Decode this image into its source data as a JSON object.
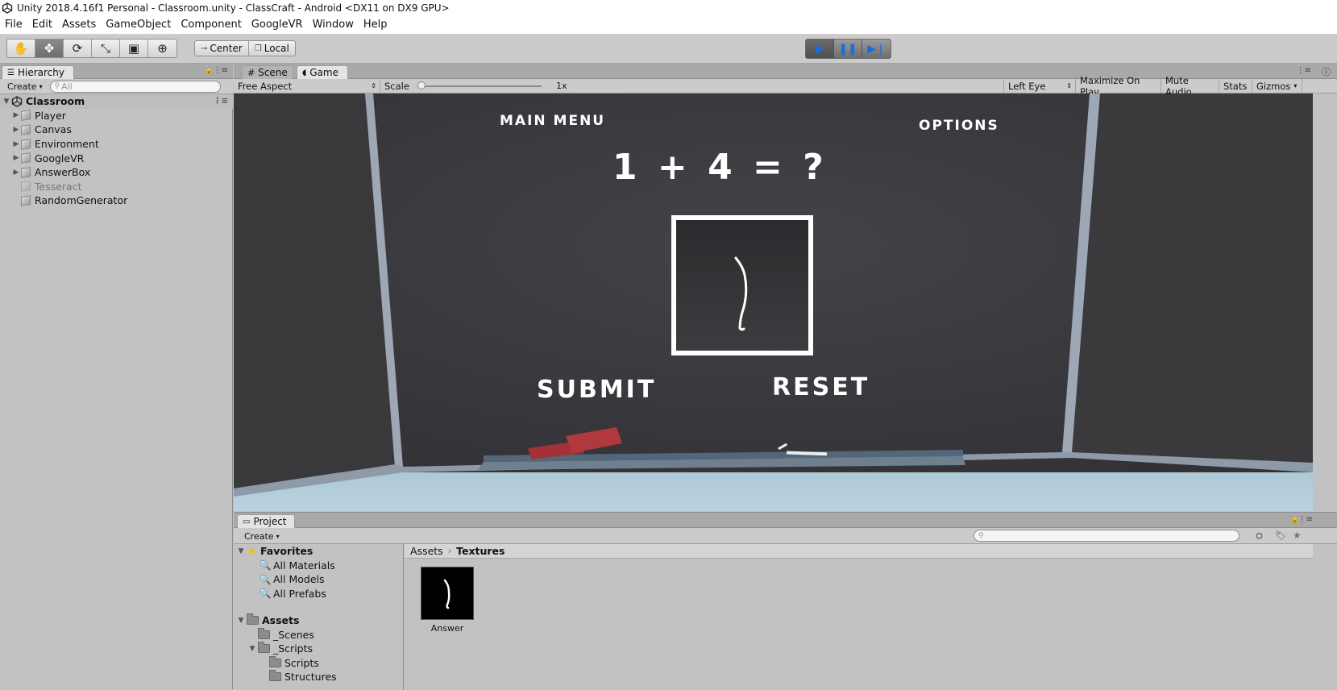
{
  "window": {
    "title": "Unity 2018.4.16f1 Personal - Classroom.unity - ClassCraft - Android <DX11 on DX9 GPU>"
  },
  "menu": [
    "File",
    "Edit",
    "Assets",
    "GameObject",
    "Component",
    "GoogleVR",
    "Window",
    "Help"
  ],
  "toolbar": {
    "pivot_center": "Center",
    "pivot_local": "Local",
    "accent": "#1a6fd6"
  },
  "hierarchy": {
    "tab": "Hierarchy",
    "create": "Create",
    "search_placeholder": "All",
    "scene": "Classroom",
    "items": [
      {
        "label": "Player",
        "expandable": true,
        "active": true
      },
      {
        "label": "Canvas",
        "expandable": true,
        "active": true
      },
      {
        "label": "Environment",
        "expandable": true,
        "active": true
      },
      {
        "label": "GoogleVR",
        "expandable": true,
        "active": true
      },
      {
        "label": "AnswerBox",
        "expandable": true,
        "active": true
      },
      {
        "label": "Tesseract",
        "expandable": false,
        "active": false
      },
      {
        "label": "RandomGenerator",
        "expandable": false,
        "active": true
      }
    ]
  },
  "view": {
    "tabs": [
      "Scene",
      "Game"
    ],
    "aspect": "Free Aspect",
    "scale_label": "Scale",
    "scale_value": "1x",
    "eye": "Left Eye",
    "maximize": "Maximize On Play",
    "mute": "Mute Audio",
    "stats": "Stats",
    "gizmos": "Gizmos"
  },
  "game": {
    "main_menu": "MAIN MENU",
    "options": "OPTIONS",
    "question": "1 + 4 = ?",
    "submit": "SUBMIT",
    "reset": "RESET"
  },
  "project": {
    "tab": "Project",
    "create": "Create",
    "favorites": "Favorites",
    "favorite_items": [
      "All Materials",
      "All Models",
      "All Prefabs"
    ],
    "assets": "Assets",
    "asset_folders": [
      {
        "label": "_Scenes",
        "indent": 1,
        "expandable": false
      },
      {
        "label": "_Scripts",
        "indent": 1,
        "expandable": true
      },
      {
        "label": "Scripts",
        "indent": 2,
        "expandable": false
      },
      {
        "label": "Structures",
        "indent": 2,
        "expandable": false
      }
    ],
    "breadcrumb": [
      "Assets",
      "Textures"
    ],
    "files": [
      {
        "label": "Answer"
      }
    ]
  }
}
